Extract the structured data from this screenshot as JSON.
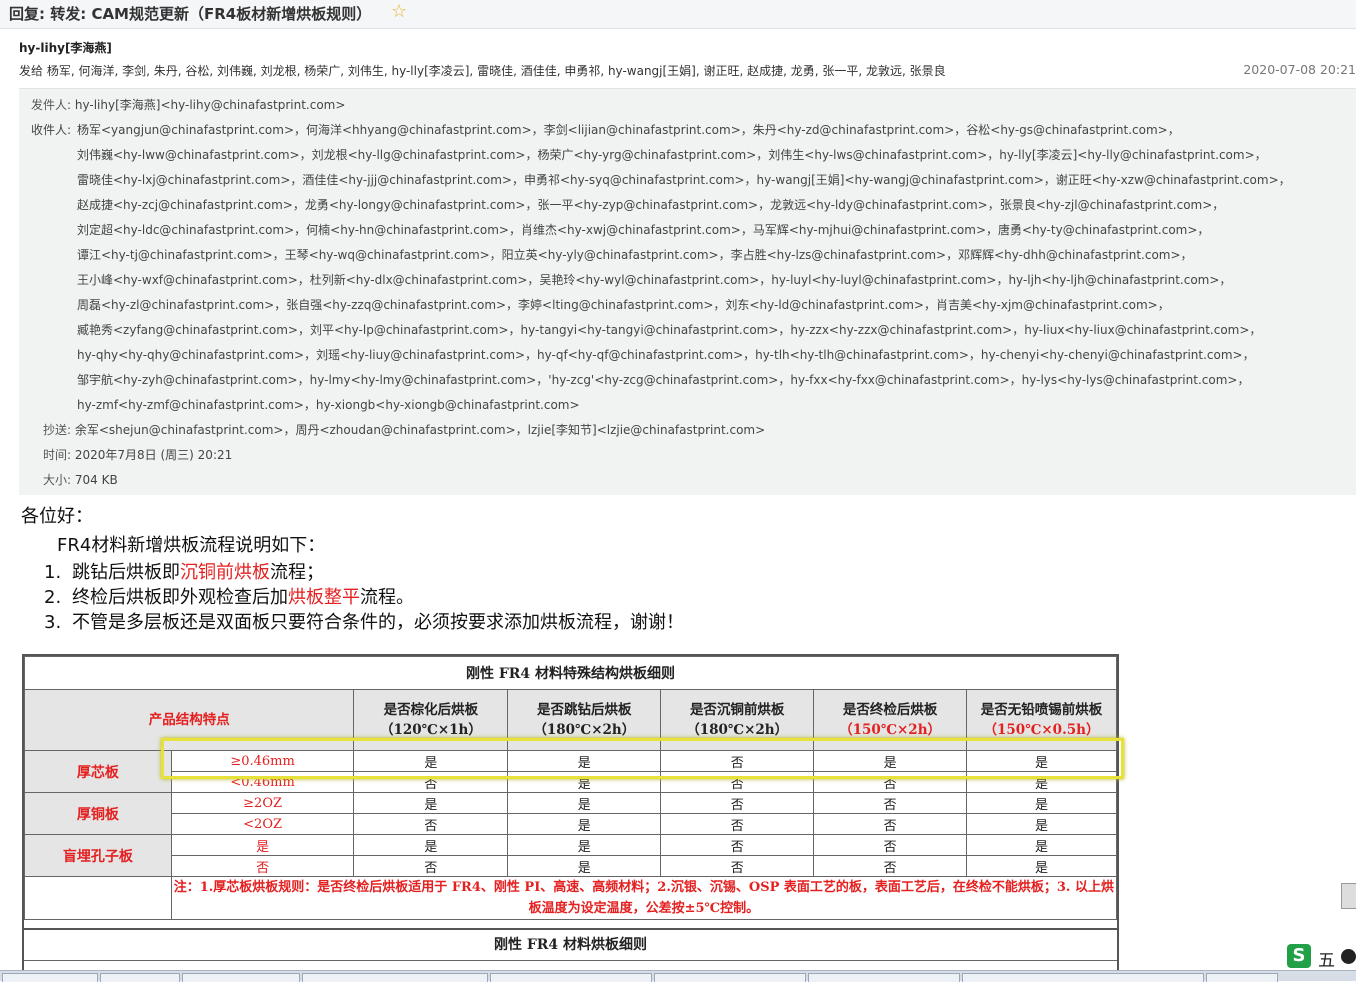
{
  "email": {
    "subject": "回复: 转发: CAM规范更新（FR4板材新增烘板规则）",
    "sender_display": "hy-lihy[李海燕]",
    "recipients_line": "发给 杨军, 何海洋, 李剑, 朱丹, 谷松, 刘伟巍, 刘龙根, 杨荣广, 刘伟生, hy-lly[李凌云], 雷晓佳, 酒佳佳, 申勇祁, hy-wangj[王娟], 谢正旺, 赵成捷, 龙勇, 张一平, 龙敦远, 张景良",
    "date": "2020-07-08 20:21"
  },
  "header": {
    "from_label": "发件人:",
    "from_value": "hy-lihy[李海燕]<hy-lihy@chinafastprint.com>",
    "to_label": "收件人:",
    "to_lines": [
      "杨军<yangjun@chinafastprint.com>，何海洋<hhyang@chinafastprint.com>，李剑<lijian@chinafastprint.com>，朱丹<hy-zd@chinafastprint.com>，谷松<hy-gs@chinafastprint.com>，",
      "刘伟巍<hy-lww@chinafastprint.com>，刘龙根<hy-llg@chinafastprint.com>，杨荣广<hy-yrg@chinafastprint.com>，刘伟生<hy-lws@chinafastprint.com>，hy-lly[李凌云]<hy-lly@chinafastprint.com>，",
      "雷晓佳<hy-lxj@chinafastprint.com>，酒佳佳<hy-jjj@chinafastprint.com>，申勇祁<hy-syq@chinafastprint.com>，hy-wangj[王娟]<hy-wangj@chinafastprint.com>，谢正旺<hy-xzw@chinafastprint.com>，",
      "赵成捷<hy-zcj@chinafastprint.com>，龙勇<hy-longy@chinafastprint.com>，张一平<hy-zyp@chinafastprint.com>，龙敦远<hy-ldy@chinafastprint.com>，张景良<hy-zjl@chinafastprint.com>，",
      "刘定超<hy-ldc@chinafastprint.com>，何楠<hy-hn@chinafastprint.com>，肖维杰<hy-xwj@chinafastprint.com>，马军辉<hy-mjhui@chinafastprint.com>，唐勇<hy-ty@chinafastprint.com>，",
      "谭江<hy-tj@chinafastprint.com>，王琴<hy-wq@chinafastprint.com>，阳立英<hy-yly@chinafastprint.com>，李占胜<hy-lzs@chinafastprint.com>，邓辉辉<hy-dhh@chinafastprint.com>，",
      "王小峰<hy-wxf@chinafastprint.com>，杜列新<hy-dlx@chinafastprint.com>，吴艳玲<hy-wyl@chinafastprint.com>，hy-luyl<hy-luyl@chinafastprint.com>，hy-ljh<hy-ljh@chinafastprint.com>，",
      "周磊<hy-zl@chinafastprint.com>，张自强<hy-zzq@chinafastprint.com>，李婷<lting@chinafastprint.com>，刘东<hy-ld@chinafastprint.com>，肖吉美<hy-xjm@chinafastprint.com>，",
      "臧艳秀<zyfang@chinafastprint.com>，刘平<hy-lp@chinafastprint.com>，hy-tangyi<hy-tangyi@chinafastprint.com>，hy-zzx<hy-zzx@chinafastprint.com>，hy-liux<hy-liux@chinafastprint.com>，",
      "hy-qhy<hy-qhy@chinafastprint.com>，刘瑶<hy-liuy@chinafastprint.com>，hy-qf<hy-qf@chinafastprint.com>，hy-tlh<hy-tlh@chinafastprint.com>，hy-chenyi<hy-chenyi@chinafastprint.com>，",
      "邹宇航<hy-zyh@chinafastprint.com>，hy-lmy<hy-lmy@chinafastprint.com>，'hy-zcg'<hy-zcg@chinafastprint.com>，hy-fxx<hy-fxx@chinafastprint.com>，hy-lys<hy-lys@chinafastprint.com>，",
      "hy-zmf<hy-zmf@chinafastprint.com>，hy-xiongb<hy-xiongb@chinafastprint.com>"
    ],
    "cc_label": "抄送:",
    "cc_value": "余军<shejun@chinafastprint.com>，周丹<zhoudan@chinafastprint.com>，lzjie[李知节]<lzjie@chinafastprint.com>",
    "time_label": "时间:",
    "time_value": "2020年7月8日 (周三) 20:21",
    "size_label": "大小:",
    "size_value": "704 KB"
  },
  "body": {
    "greeting": "各位好：",
    "intro": "FR4材料新增烘板流程说明如下：",
    "items": [
      {
        "num": "1.",
        "pre": "跳钻后烘板即",
        "red": "沉铜前烘板",
        "post": "流程；"
      },
      {
        "num": "2.",
        "pre": "终检后烘板即外观检查后加",
        "red": "烘板整平",
        "post": "流程。"
      },
      {
        "num": "3.",
        "pre": "不管是多层板还是双面板只要符合条件的，必须按要求添加烘板流程，谢谢！",
        "red": "",
        "post": ""
      }
    ]
  },
  "table": {
    "title": "刚性 FR4 材料特殊结构烘板细则",
    "feature_header": "产品结构特点",
    "columns": [
      {
        "label": "是否棕化后烘板",
        "cond": "（120℃×1h）",
        "red": false
      },
      {
        "label": "是否跳钻后烘板",
        "cond": "（180℃×2h）",
        "red": false
      },
      {
        "label": "是否沉铜前烘板",
        "cond": "（180℃×2h）",
        "red": false
      },
      {
        "label": "是否终检后烘板",
        "cond": "（150℃×2h）",
        "red": true
      },
      {
        "label": "是否无铅喷锡前烘板",
        "cond": "（150℃×0.5h）",
        "red": true
      }
    ],
    "groups": [
      {
        "name": "厚芯板",
        "rows": [
          {
            "sub": "≥0.46mm",
            "vals": [
              "是",
              "是",
              "否",
              "是",
              "是"
            ]
          },
          {
            "sub": "<0.46mm",
            "vals": [
              "否",
              "是",
              "否",
              "否",
              "是"
            ]
          }
        ]
      },
      {
        "name": "厚铜板",
        "rows": [
          {
            "sub": "≥2OZ",
            "vals": [
              "是",
              "是",
              "否",
              "否",
              "是"
            ]
          },
          {
            "sub": "<2OZ",
            "vals": [
              "否",
              "是",
              "否",
              "否",
              "是"
            ]
          }
        ]
      },
      {
        "name": "盲埋孔子板",
        "rows": [
          {
            "sub": "是",
            "vals": [
              "是",
              "是",
              "否",
              "否",
              "是"
            ]
          },
          {
            "sub": "否",
            "vals": [
              "否",
              "是",
              "否",
              "否",
              "是"
            ]
          }
        ]
      }
    ],
    "note": "注：1.厚芯板烘板规则：是否终检后烘板适用于 FR4、刚性 PI、高速、高频材料；2.沉银、沉锡、OSP 表面工艺的板，表面工艺后，在终检不能烘板；3. 以上烘板温度为设定温度，公差按±5℃控制。",
    "title2": "刚性 FR4 材料烘板细则"
  },
  "ime": {
    "logo": "S",
    "mode": "五"
  }
}
